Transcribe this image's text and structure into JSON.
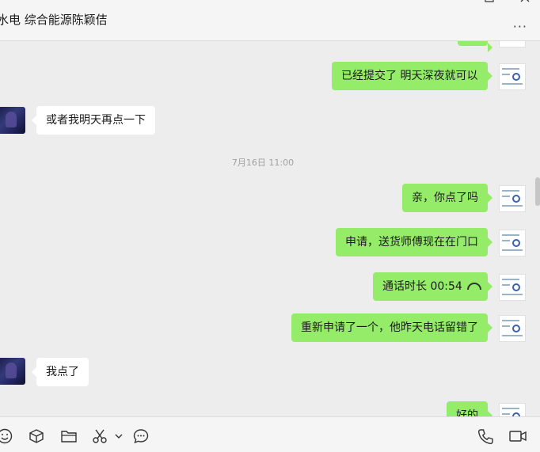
{
  "header": {
    "title": "水电 综合能源陈颖佶",
    "more_label": "···",
    "window_controls": [
      "maximize-icon",
      "close-icon"
    ]
  },
  "messages": [
    {
      "direction": "out",
      "text": "已经提交了 明天深夜就可以"
    },
    {
      "direction": "in",
      "text": "或者我明天再点一下"
    },
    {
      "type": "timestamp",
      "text": "7月16日 11:00"
    },
    {
      "direction": "out",
      "text": "亲，你点了吗"
    },
    {
      "direction": "out",
      "text": "申请，送货师傅现在在门口"
    },
    {
      "direction": "out",
      "text": "通话时长 00:54",
      "icon": "phone-hangup-icon"
    },
    {
      "direction": "out",
      "text": "重新申请了一个，他昨天电话留错了"
    },
    {
      "direction": "in",
      "text": "我点了"
    },
    {
      "direction": "out",
      "text": "好的"
    }
  ],
  "toolbar": {
    "icons": [
      "emoji-icon",
      "sticker-box-icon",
      "folder-icon",
      "scissors-icon",
      "chevron-down-icon",
      "chat-history-icon",
      "voice-call-icon",
      "video-call-icon"
    ]
  },
  "colors": {
    "outgoing_bubble": "#95ec69",
    "incoming_bubble": "#ffffff",
    "background": "#ededed"
  }
}
